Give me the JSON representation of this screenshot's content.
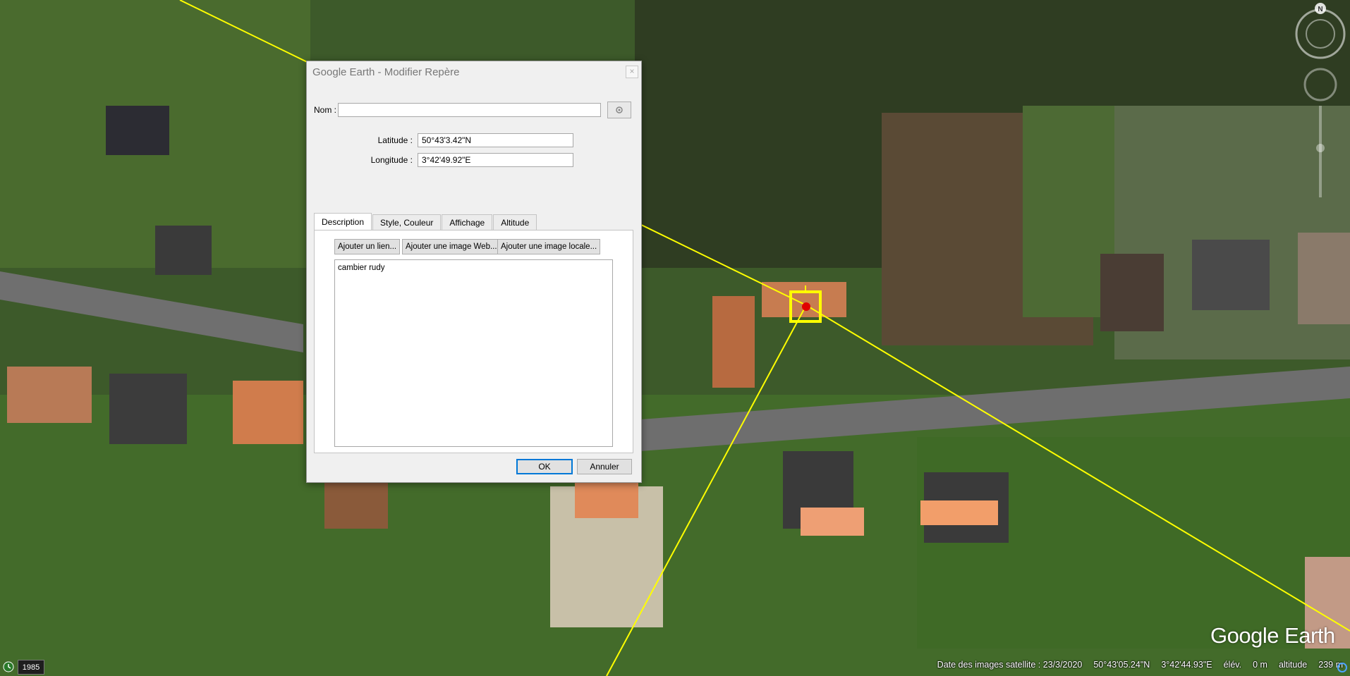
{
  "dialog": {
    "title": "Google Earth - Modifier Repère",
    "close_label": "×",
    "name_label": "Nom :",
    "name_value": "",
    "latitude_label": "Latitude :",
    "latitude_value": "50°43'3.42\"N",
    "longitude_label": "Longitude :",
    "longitude_value": "3°42'49.92\"E",
    "tabs": [
      "Description",
      "Style, Couleur",
      "Affichage",
      "Altitude"
    ],
    "active_tab": "Description",
    "buttons": {
      "add_link": "Ajouter un lien...",
      "add_web_image": "Ajouter une image Web...",
      "add_local_image": "Ajouter une image locale..."
    },
    "description_text": "cambier rudy",
    "ok_label": "OK",
    "cancel_label": "Annuler"
  },
  "statusbar": {
    "year": "1985",
    "imagery_date": "Date des images satellite : 23/3/2020",
    "lat": "50°43'05.24\"N",
    "lon": "3°42'44.93\"E",
    "elev_label": "élév.",
    "elev_value": "0 m",
    "altitude_label": "altitude",
    "altitude_value": "239 m"
  },
  "logo": "Google Earth",
  "compass_north": "N",
  "colors": {
    "path_line": "#ffff00",
    "placemark": "#e00000",
    "dialog_bg": "#f0f0f0",
    "ok_focus": "#0078d7"
  }
}
